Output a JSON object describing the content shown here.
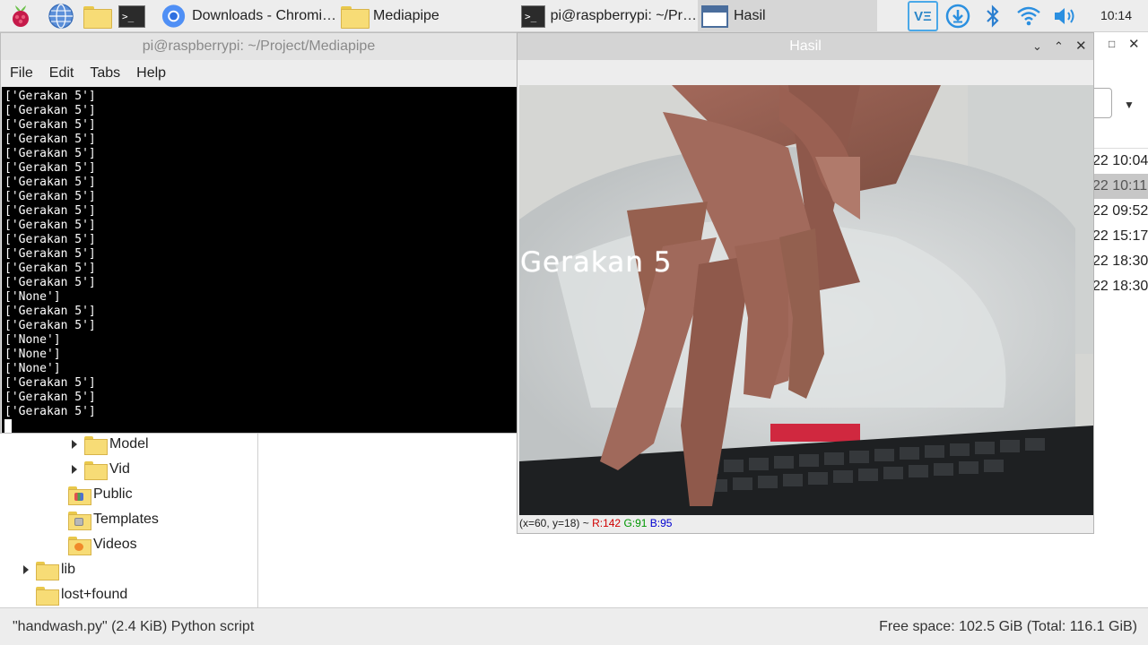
{
  "taskbar": {
    "tasks": [
      {
        "label": "Downloads - Chromi…"
      },
      {
        "label": "Mediapipe"
      },
      {
        "label": "pi@raspberrypi: ~/Pr…"
      },
      {
        "label": "Hasil"
      }
    ],
    "tray": {
      "vnc_label": "VΞ"
    },
    "clock": "10:14"
  },
  "terminal": {
    "title": "pi@raspberrypi: ~/Project/Mediapipe",
    "menu": [
      "File",
      "Edit",
      "Tabs",
      "Help"
    ],
    "lines": [
      "['Gerakan 5']",
      "['Gerakan 5']",
      "['Gerakan 5']",
      "['Gerakan 5']",
      "['Gerakan 5']",
      "['Gerakan 5']",
      "['Gerakan 5']",
      "['Gerakan 5']",
      "['Gerakan 5']",
      "['Gerakan 5']",
      "['Gerakan 5']",
      "['Gerakan 5']",
      "['Gerakan 5']",
      "['Gerakan 5']",
      "['None']",
      "['Gerakan 5']",
      "['Gerakan 5']",
      "['None']",
      "['None']",
      "['None']",
      "['Gerakan 5']",
      "['Gerakan 5']",
      "['Gerakan 5']"
    ]
  },
  "hasil": {
    "title": "Hasil",
    "overlay_label": "Gerakan 5",
    "status": {
      "coords": "(x=60, y=18) ~",
      "r": "R:142",
      "g": "G:91",
      "b": "B:95"
    }
  },
  "file_manager": {
    "tree": [
      {
        "label": "Model",
        "expandable": true,
        "icon": "folder-icon"
      },
      {
        "label": "Vid",
        "expandable": true,
        "icon": "folder-icon"
      },
      {
        "label": "Public",
        "expandable": false,
        "icon": "public-folder-icon"
      },
      {
        "label": "Templates",
        "expandable": false,
        "icon": "templates-folder-icon"
      },
      {
        "label": "Videos",
        "expandable": false,
        "icon": "videos-folder-icon"
      },
      {
        "label": "lib",
        "expandable": true,
        "icon": "folder-icon"
      },
      {
        "label": "lost+found",
        "expandable": false,
        "icon": "folder-icon"
      }
    ],
    "dates": [
      "22 10:04",
      "22 10:11",
      "22 09:52",
      "22 15:17",
      "22 18:30",
      "22 18:30"
    ],
    "selected_date_index": 1,
    "status_left": "\"handwash.py\" (2.4 KiB) Python script",
    "status_right": "Free space: 102.5 GiB (Total: 116.1 GiB)"
  },
  "colors": {
    "accent": "#4a6d9c",
    "terminal_bg": "#000000",
    "selection": "#c7c7c7"
  }
}
